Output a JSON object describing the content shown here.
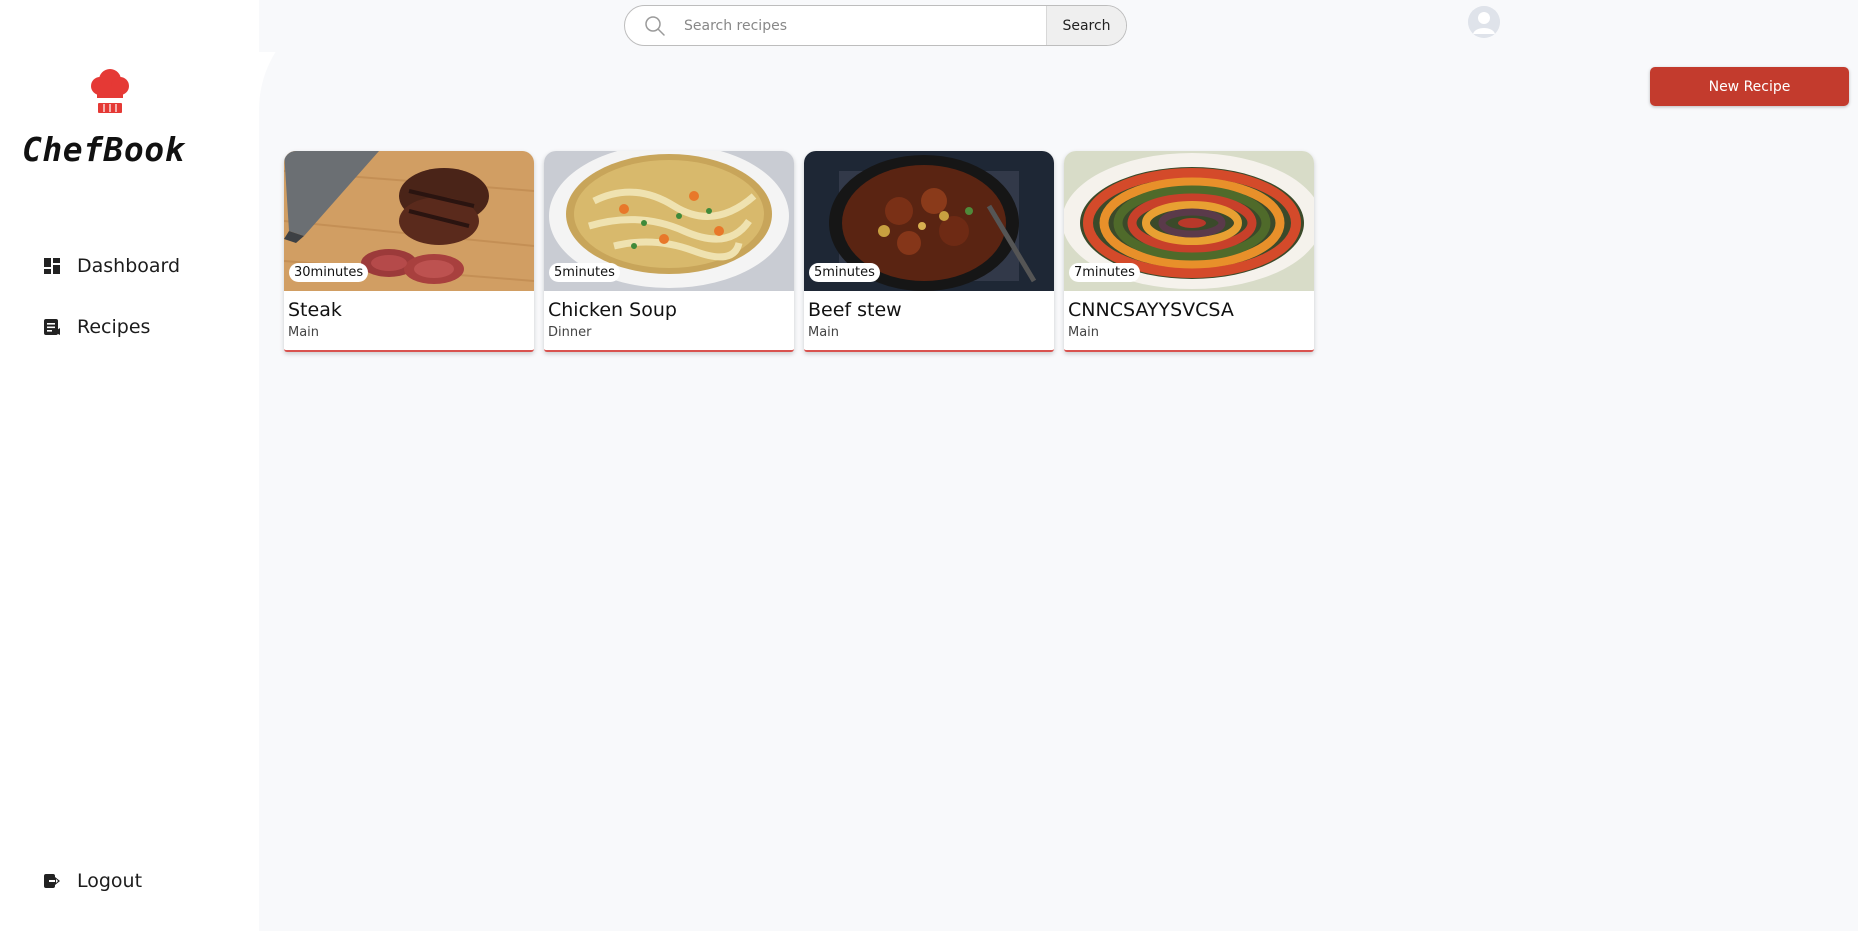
{
  "app": {
    "name": "ChefBook",
    "brand_color": "#e53935",
    "accent": "#c33b2d"
  },
  "sidebar": {
    "items": [
      {
        "label": "Dashboard",
        "icon": "dashboard-icon"
      },
      {
        "label": "Recipes",
        "icon": "recipe-book-icon"
      }
    ],
    "logout_label": "Logout",
    "logout_icon": "logout-icon"
  },
  "header": {
    "search": {
      "placeholder": "Search recipes",
      "value": "",
      "button_label": "Search"
    },
    "avatar": "user-avatar-icon"
  },
  "toolbar": {
    "new_recipe_label": "New Recipe"
  },
  "recipes": [
    {
      "title": "Steak",
      "category": "Main",
      "time": "30minutes",
      "image": "steak"
    },
    {
      "title": "Chicken Soup",
      "category": "Dinner",
      "time": "5minutes",
      "image": "chicken-soup"
    },
    {
      "title": "Beef stew",
      "category": "Main",
      "time": "5minutes",
      "image": "beef-stew"
    },
    {
      "title": "CNNCSAYYSVCSA",
      "category": "Main",
      "time": "7minutes",
      "image": "ratatouille"
    }
  ]
}
